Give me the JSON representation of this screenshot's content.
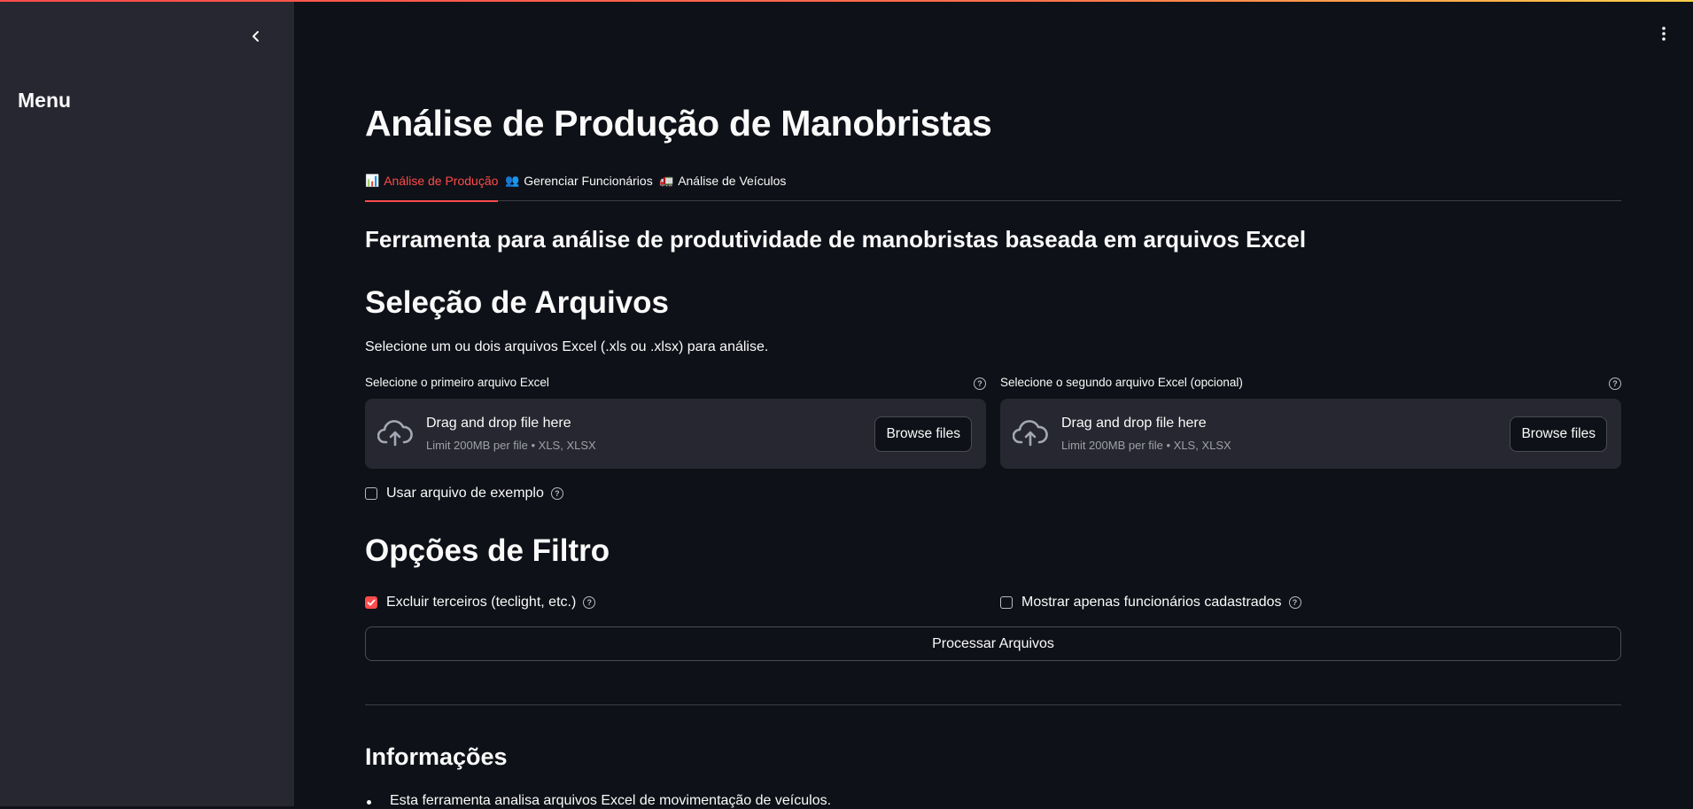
{
  "sidebar": {
    "title": "Menu"
  },
  "page": {
    "title": "Análise de Produção de Manobristas"
  },
  "tabs": [
    {
      "icon": "📊",
      "label": "Análise de Produção",
      "active": true
    },
    {
      "icon": "👥",
      "label": "Gerenciar Funcionários",
      "active": false
    },
    {
      "icon": "🚛",
      "label": "Análise de Veículos",
      "active": false
    }
  ],
  "subtitle": "Ferramenta para análise de produtividade de manobristas baseada em arquivos Excel",
  "files_section": {
    "heading": "Seleção de Arquivos",
    "description": "Selecione um ou dois arquivos Excel (.xls ou .xlsx) para análise.",
    "uploader1": {
      "label": "Selecione o primeiro arquivo Excel",
      "drop_text": "Drag and drop file here",
      "limit_text": "Limit 200MB per file • XLS, XLSX",
      "button": "Browse files"
    },
    "uploader2": {
      "label": "Selecione o segundo arquivo Excel (opcional)",
      "drop_text": "Drag and drop file here",
      "limit_text": "Limit 200MB per file • XLS, XLSX",
      "button": "Browse files"
    },
    "example_checkbox": {
      "label": "Usar arquivo de exemplo",
      "checked": false
    }
  },
  "filter_section": {
    "heading": "Opções de Filtro",
    "exclude_checkbox": {
      "label": "Excluir terceiros (teclight, etc.)",
      "checked": true
    },
    "registered_checkbox": {
      "label": "Mostrar apenas funcionários cadastrados",
      "checked": false
    },
    "process_button": "Processar Arquivos"
  },
  "info_section": {
    "heading": "Informações",
    "bullets": [
      "Esta ferramenta analisa arquivos Excel de movimentação de veículos."
    ]
  },
  "colors": {
    "accent": "#ff4b4b",
    "background": "#0e1117",
    "sidebar": "#262730"
  }
}
